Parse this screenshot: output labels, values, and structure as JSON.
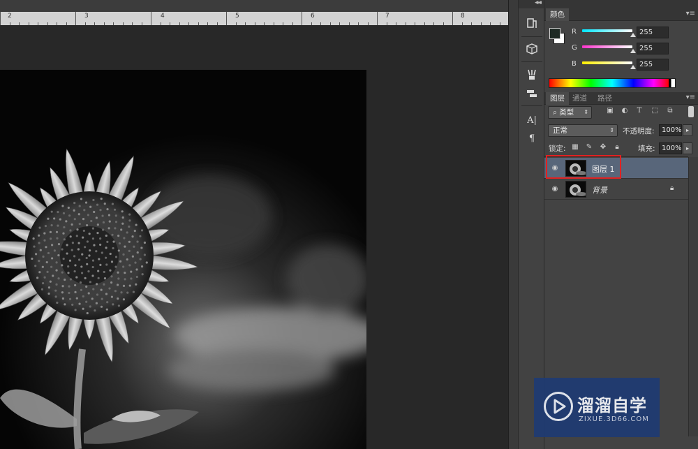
{
  "ruler": {
    "numbers": [
      "2",
      "3",
      "4",
      "5",
      "6",
      "7",
      "8"
    ]
  },
  "toolstrip": {
    "collapse_glyph": "◂◂",
    "tools": [
      "history-brush-icon",
      "3d-cube-icon",
      "brush-presets-icon",
      "tool-presets-icon",
      "character-icon",
      "paragraph-icon"
    ]
  },
  "panels": {
    "collapse_glyph": "◂◂",
    "color": {
      "tab_label": "颜色",
      "channels": [
        {
          "label": "R",
          "value": "255",
          "color": "#00e5ff"
        },
        {
          "label": "G",
          "value": "255",
          "color": "#ff33cc"
        },
        {
          "label": "B",
          "value": "255",
          "color": "#ffee00"
        }
      ],
      "foreground": "#1e2a24",
      "background": "#ffffff"
    },
    "layers": {
      "tabs": [
        "图层",
        "通道",
        "路径"
      ],
      "filter_kind": "类型",
      "blend_mode": "正常",
      "opacity_label": "不透明度:",
      "opacity_value": "100%",
      "lock_label": "锁定:",
      "fill_label": "填充:",
      "fill_value": "100%",
      "items": [
        {
          "name": "图层 1",
          "selected": true
        },
        {
          "name": "背景",
          "selected": false,
          "locked": true
        }
      ]
    }
  },
  "watermark": {
    "title": "溜溜自学",
    "url": "ZIXUE.3D66.COM"
  },
  "colors": {
    "selection_blue": "#58667a",
    "highlight_red": "#e02222"
  }
}
